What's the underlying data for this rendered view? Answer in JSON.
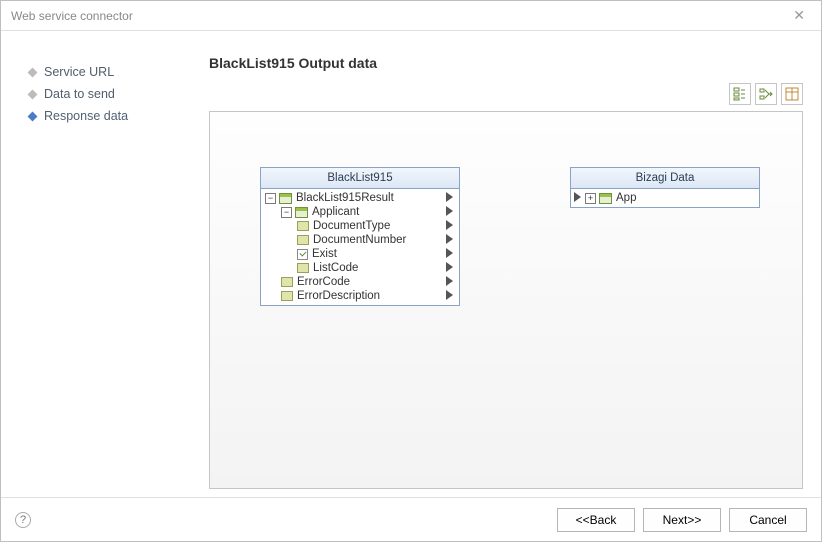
{
  "window": {
    "title": "Web service connector"
  },
  "sidebar": {
    "items": [
      {
        "label": "Service URL",
        "active": false
      },
      {
        "label": "Data to send",
        "active": false
      },
      {
        "label": "Response data",
        "active": true
      }
    ]
  },
  "main": {
    "heading": "BlackList915 Output data",
    "source_block": {
      "title": "BlackList915",
      "tree": [
        {
          "depth": 0,
          "expander": "minus",
          "icon": "table",
          "label": "BlackList915Result",
          "out": true
        },
        {
          "depth": 1,
          "expander": "minus",
          "icon": "table",
          "label": "Applicant",
          "out": true
        },
        {
          "depth": 2,
          "expander": null,
          "icon": "field",
          "label": "DocumentType",
          "out": true
        },
        {
          "depth": 2,
          "expander": null,
          "icon": "field",
          "label": "DocumentNumber",
          "out": true
        },
        {
          "depth": 2,
          "expander": null,
          "icon": "check",
          "label": "Exist",
          "out": true
        },
        {
          "depth": 2,
          "expander": null,
          "icon": "field",
          "label": "ListCode",
          "out": true
        },
        {
          "depth": 1,
          "expander": null,
          "icon": "field",
          "label": "ErrorCode",
          "out": true
        },
        {
          "depth": 1,
          "expander": null,
          "icon": "field",
          "label": "ErrorDescription",
          "out": true
        }
      ]
    },
    "target_block": {
      "title": "Bizagi Data",
      "tree": [
        {
          "depth": 0,
          "expander": "plus",
          "icon": "table",
          "label": "App",
          "in": true
        }
      ]
    }
  },
  "footer": {
    "back": "<<Back",
    "next": "Next>>",
    "cancel": "Cancel"
  }
}
